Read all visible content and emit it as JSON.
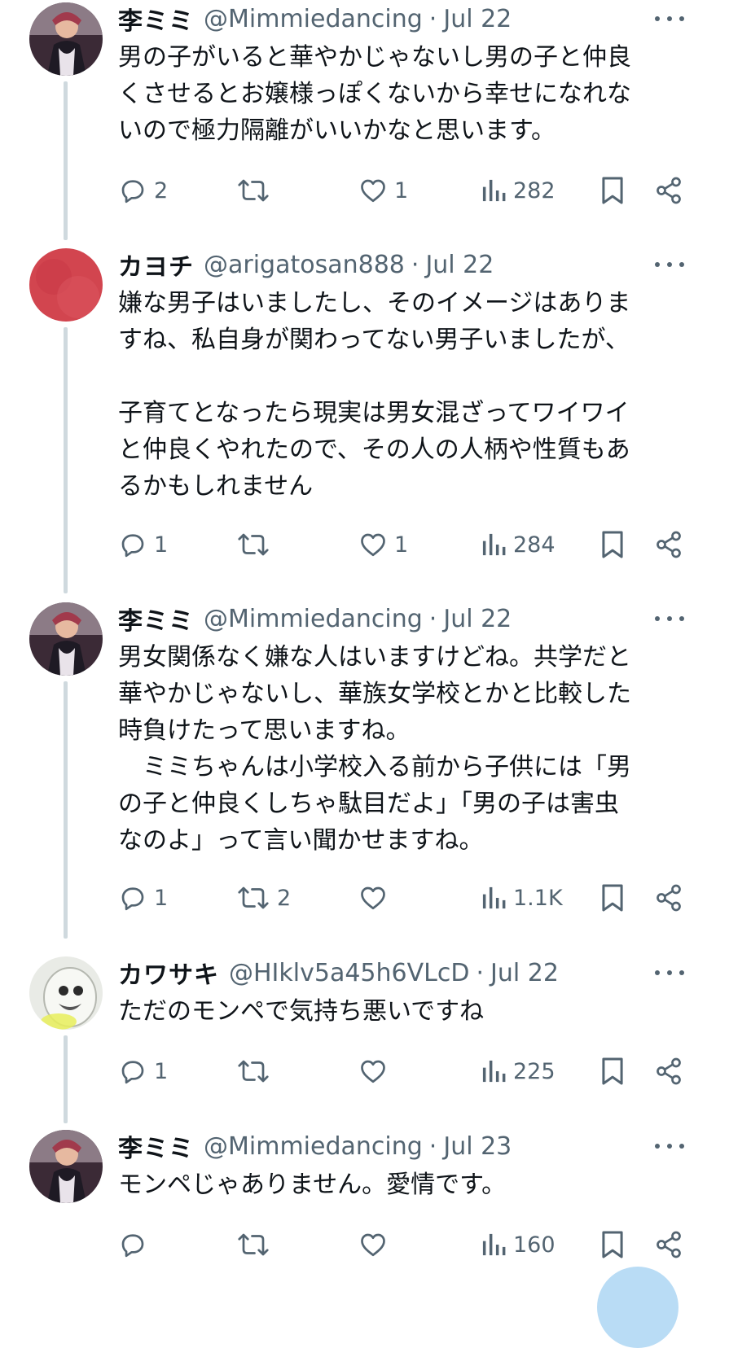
{
  "tweets": [
    {
      "name": "李ミミ",
      "handle": "@Mimmiedancing",
      "date": "Jul 22",
      "text": "男の子がいると華やかじゃないし男の子と仲良\nくさせるとお嬢様っぽくないから幸せになれな\nいので極力隔離がいいかなと思います。",
      "avatar": "avatar-portrait",
      "replies": "2",
      "retweets": "",
      "likes": "1",
      "views": "282"
    },
    {
      "name": "カヨチ",
      "handle": "@arigatosan888",
      "date": "Jul 22",
      "text": "嫌な男子はいましたし、そのイメージはありま\nすね、私自身が関わってない男子いましたが、\n\n子育てとなったら現実は男女混ざってワイワイ\nと仲良くやれたので、その人の人柄や性質もあ\nるかもしれません",
      "avatar": "avatar-red",
      "replies": "1",
      "retweets": "",
      "likes": "1",
      "views": "284"
    },
    {
      "name": "李ミミ",
      "handle": "@Mimmiedancing",
      "date": "Jul 22",
      "text": "男女関係なく嫌な人はいますけどね。共学だと\n華やかじゃないし、華族女学校とかと比較した\n時負けたって思いますね。\n　ミミちゃんは小学校入る前から子供には「男\nの子と仲良くしちゃ駄目だよ」「男の子は害虫\nなのよ」って言い聞かせますね。",
      "avatar": "avatar-portrait",
      "replies": "1",
      "retweets": "2",
      "likes": "",
      "views": "1.1K"
    },
    {
      "name": "カワサキ",
      "handle": "@HIklv5a45h6VLcD",
      "date": "Jul 22",
      "text": "ただのモンペで気持ち悪いですね",
      "avatar": "avatar-ghost",
      "replies": "1",
      "retweets": "",
      "likes": "",
      "views": "225"
    },
    {
      "name": "李ミミ",
      "handle": "@Mimmiedancing",
      "date": "Jul 23",
      "text": "モンペじゃありません。愛情です。",
      "avatar": "avatar-portrait",
      "replies": "",
      "retweets": "",
      "likes": "",
      "views": "160"
    }
  ],
  "separator": "·",
  "icons": [
    "reply-icon",
    "retweet-icon",
    "like-icon",
    "views-icon",
    "bookmark-icon",
    "share-icon",
    "more-icon"
  ],
  "colors": {
    "text": "#0f1419",
    "secondary": "#536471",
    "thread_line": "#cfd9de",
    "fab": "#b9dcf5"
  }
}
